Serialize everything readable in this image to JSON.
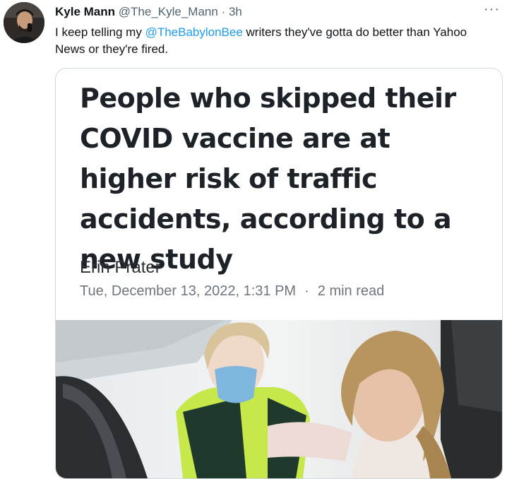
{
  "tweet": {
    "author_name": "Kyle Mann",
    "author_handle": "@The_Kyle_Mann",
    "separator": "·",
    "time": "3h",
    "more_label": "···",
    "text_before": "I keep telling my ",
    "mention": "@TheBabylonBee",
    "text_after": " writers they've gotta do better than Yahoo News or they're fired."
  },
  "card": {
    "headline": "People who skipped their COVID vaccine are at higher risk of traffic accidents, according to a new study",
    "author": "Erin Prater",
    "date": "Tue, December 13, 2022, 1:31 PM",
    "separator": "·",
    "read_time": "2 min read"
  },
  "colors": {
    "text": "#0f1419",
    "muted": "#536471",
    "link": "#1d9bf0",
    "border": "#cfd9de",
    "paramedic_vest": "#c6e84a",
    "mask": "#7fb6dd"
  }
}
